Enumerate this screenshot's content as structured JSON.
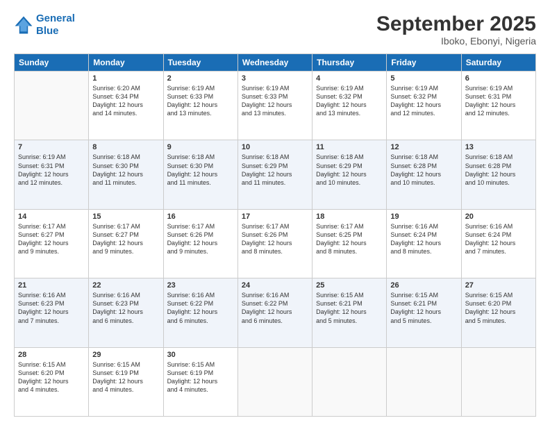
{
  "logo": {
    "line1": "General",
    "line2": "Blue"
  },
  "title": "September 2025",
  "subtitle": "Iboko, Ebonyi, Nigeria",
  "days_of_week": [
    "Sunday",
    "Monday",
    "Tuesday",
    "Wednesday",
    "Thursday",
    "Friday",
    "Saturday"
  ],
  "weeks": [
    [
      {
        "day": "",
        "info": ""
      },
      {
        "day": "1",
        "info": "Sunrise: 6:20 AM\nSunset: 6:34 PM\nDaylight: 12 hours\nand 14 minutes."
      },
      {
        "day": "2",
        "info": "Sunrise: 6:19 AM\nSunset: 6:33 PM\nDaylight: 12 hours\nand 13 minutes."
      },
      {
        "day": "3",
        "info": "Sunrise: 6:19 AM\nSunset: 6:33 PM\nDaylight: 12 hours\nand 13 minutes."
      },
      {
        "day": "4",
        "info": "Sunrise: 6:19 AM\nSunset: 6:32 PM\nDaylight: 12 hours\nand 13 minutes."
      },
      {
        "day": "5",
        "info": "Sunrise: 6:19 AM\nSunset: 6:32 PM\nDaylight: 12 hours\nand 12 minutes."
      },
      {
        "day": "6",
        "info": "Sunrise: 6:19 AM\nSunset: 6:31 PM\nDaylight: 12 hours\nand 12 minutes."
      }
    ],
    [
      {
        "day": "7",
        "info": "Sunrise: 6:19 AM\nSunset: 6:31 PM\nDaylight: 12 hours\nand 12 minutes."
      },
      {
        "day": "8",
        "info": "Sunrise: 6:18 AM\nSunset: 6:30 PM\nDaylight: 12 hours\nand 11 minutes."
      },
      {
        "day": "9",
        "info": "Sunrise: 6:18 AM\nSunset: 6:30 PM\nDaylight: 12 hours\nand 11 minutes."
      },
      {
        "day": "10",
        "info": "Sunrise: 6:18 AM\nSunset: 6:29 PM\nDaylight: 12 hours\nand 11 minutes."
      },
      {
        "day": "11",
        "info": "Sunrise: 6:18 AM\nSunset: 6:29 PM\nDaylight: 12 hours\nand 10 minutes."
      },
      {
        "day": "12",
        "info": "Sunrise: 6:18 AM\nSunset: 6:28 PM\nDaylight: 12 hours\nand 10 minutes."
      },
      {
        "day": "13",
        "info": "Sunrise: 6:18 AM\nSunset: 6:28 PM\nDaylight: 12 hours\nand 10 minutes."
      }
    ],
    [
      {
        "day": "14",
        "info": "Sunrise: 6:17 AM\nSunset: 6:27 PM\nDaylight: 12 hours\nand 9 minutes."
      },
      {
        "day": "15",
        "info": "Sunrise: 6:17 AM\nSunset: 6:27 PM\nDaylight: 12 hours\nand 9 minutes."
      },
      {
        "day": "16",
        "info": "Sunrise: 6:17 AM\nSunset: 6:26 PM\nDaylight: 12 hours\nand 9 minutes."
      },
      {
        "day": "17",
        "info": "Sunrise: 6:17 AM\nSunset: 6:26 PM\nDaylight: 12 hours\nand 8 minutes."
      },
      {
        "day": "18",
        "info": "Sunrise: 6:17 AM\nSunset: 6:25 PM\nDaylight: 12 hours\nand 8 minutes."
      },
      {
        "day": "19",
        "info": "Sunrise: 6:16 AM\nSunset: 6:24 PM\nDaylight: 12 hours\nand 8 minutes."
      },
      {
        "day": "20",
        "info": "Sunrise: 6:16 AM\nSunset: 6:24 PM\nDaylight: 12 hours\nand 7 minutes."
      }
    ],
    [
      {
        "day": "21",
        "info": "Sunrise: 6:16 AM\nSunset: 6:23 PM\nDaylight: 12 hours\nand 7 minutes."
      },
      {
        "day": "22",
        "info": "Sunrise: 6:16 AM\nSunset: 6:23 PM\nDaylight: 12 hours\nand 6 minutes."
      },
      {
        "day": "23",
        "info": "Sunrise: 6:16 AM\nSunset: 6:22 PM\nDaylight: 12 hours\nand 6 minutes."
      },
      {
        "day": "24",
        "info": "Sunrise: 6:16 AM\nSunset: 6:22 PM\nDaylight: 12 hours\nand 6 minutes."
      },
      {
        "day": "25",
        "info": "Sunrise: 6:15 AM\nSunset: 6:21 PM\nDaylight: 12 hours\nand 5 minutes."
      },
      {
        "day": "26",
        "info": "Sunrise: 6:15 AM\nSunset: 6:21 PM\nDaylight: 12 hours\nand 5 minutes."
      },
      {
        "day": "27",
        "info": "Sunrise: 6:15 AM\nSunset: 6:20 PM\nDaylight: 12 hours\nand 5 minutes."
      }
    ],
    [
      {
        "day": "28",
        "info": "Sunrise: 6:15 AM\nSunset: 6:20 PM\nDaylight: 12 hours\nand 4 minutes."
      },
      {
        "day": "29",
        "info": "Sunrise: 6:15 AM\nSunset: 6:19 PM\nDaylight: 12 hours\nand 4 minutes."
      },
      {
        "day": "30",
        "info": "Sunrise: 6:15 AM\nSunset: 6:19 PM\nDaylight: 12 hours\nand 4 minutes."
      },
      {
        "day": "",
        "info": ""
      },
      {
        "day": "",
        "info": ""
      },
      {
        "day": "",
        "info": ""
      },
      {
        "day": "",
        "info": ""
      }
    ]
  ]
}
